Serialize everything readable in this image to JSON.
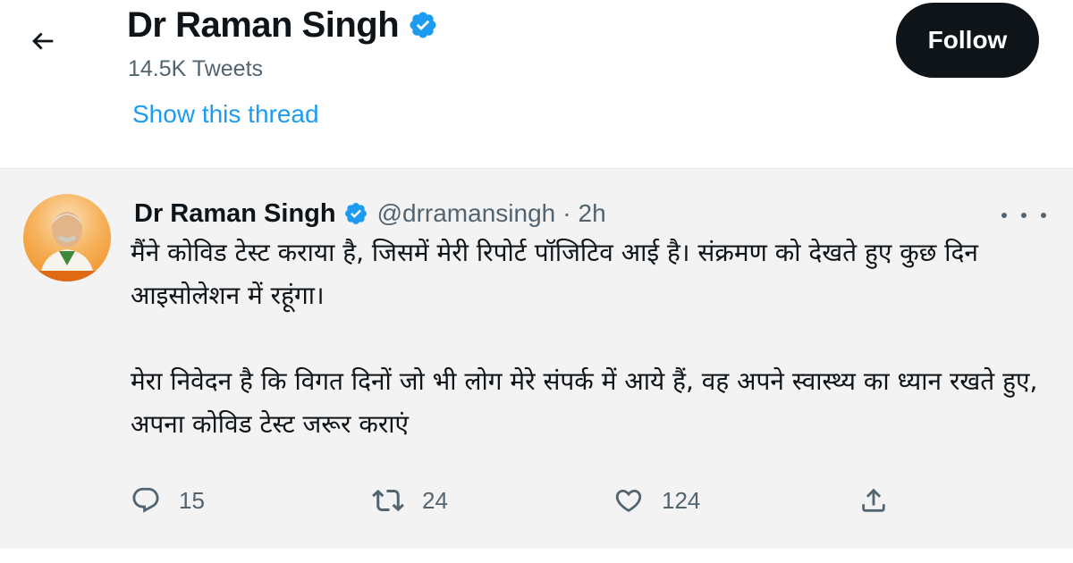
{
  "header": {
    "back_icon": "arrow-left-icon",
    "name": "Dr Raman Singh",
    "verified_icon": "verified-badge-icon",
    "tweet_count": "14.5K Tweets",
    "show_thread": "Show this thread",
    "follow_label": "Follow"
  },
  "tweet": {
    "author_name": "Dr Raman Singh",
    "handle": "@drramansingh",
    "separator": "·",
    "time": "2h",
    "more_icon": "more-dots-icon",
    "paragraphs": [
      "मैंने कोविड टेस्ट कराया है, जिसमें मेरी रिपोर्ट पॉजिटिव आई है। संक्रमण को देखते हुए कुछ दिन आइसोलेशन में रहूंगा।",
      "मेरा निवेदन है कि विगत दिनों जो भी लोग मेरे संपर्क में आये हैं, वह अपने स्वास्थ्य का ध्यान रखते हुए, अपना कोविड टेस्ट जरूर कराएं"
    ],
    "actions": {
      "reply": {
        "icon": "reply-icon",
        "count": "15"
      },
      "retweet": {
        "icon": "retweet-icon",
        "count": "24"
      },
      "like": {
        "icon": "heart-icon",
        "count": "124"
      },
      "share": {
        "icon": "share-icon"
      }
    }
  },
  "colors": {
    "accent": "#1d9bf0",
    "text": "#0f1419",
    "muted": "#536471",
    "tweet_bg": "#f3f3f3",
    "follow_bg": "#0f1419"
  }
}
